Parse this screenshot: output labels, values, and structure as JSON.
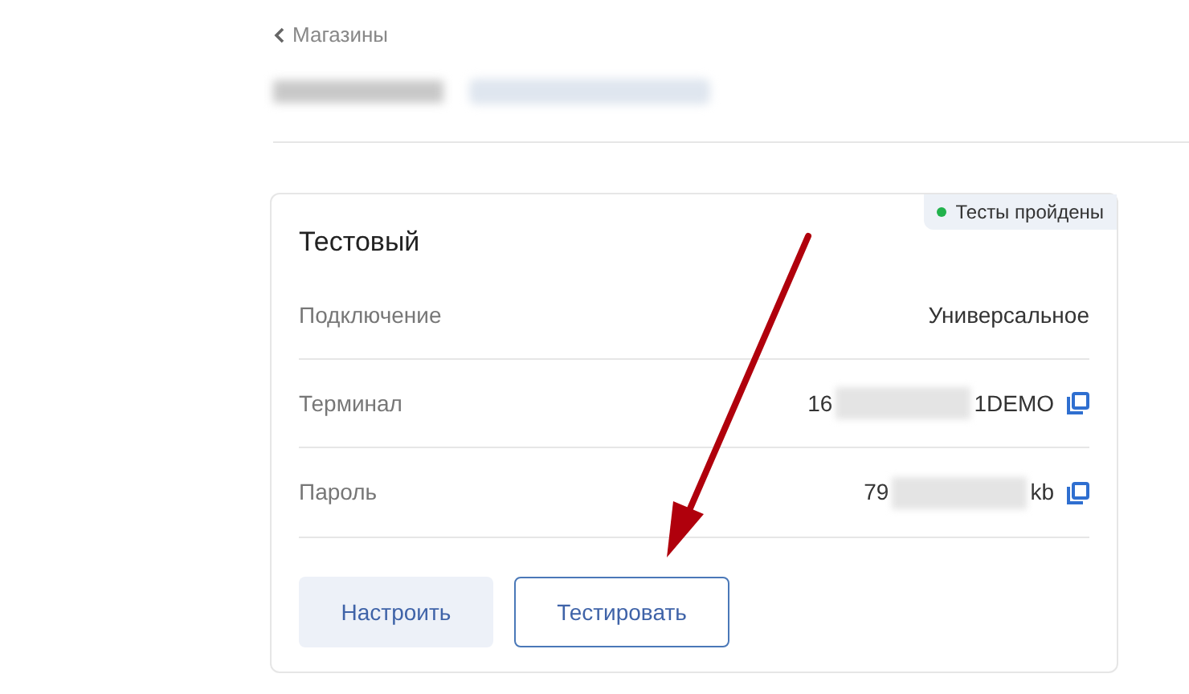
{
  "back_link": "Магазины",
  "card": {
    "title": "Тестовый",
    "status": {
      "label": "Тесты пройдены",
      "color": "#22b24c"
    },
    "rows": [
      {
        "kind": "plain",
        "label": "Подключение",
        "value": "Универсальное"
      },
      {
        "kind": "secret",
        "label": "Терминал",
        "value_start": "16",
        "value_end": "1DEMO"
      },
      {
        "kind": "secret",
        "label": "Пароль",
        "value_start": "79",
        "value_end": "kb"
      }
    ],
    "buttons": [
      {
        "label": "Настроить",
        "kind": "filled"
      },
      {
        "label": "Тестировать",
        "kind": "outline"
      }
    ]
  }
}
